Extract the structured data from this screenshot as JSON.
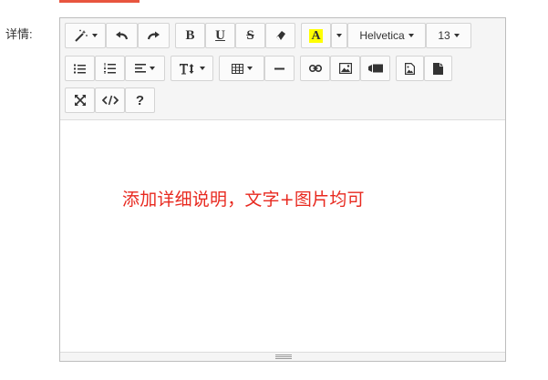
{
  "form": {
    "detail_label": "详情:"
  },
  "toolbar": {
    "font_name": "Helvetica",
    "font_size": "13",
    "highlight_letter": "A",
    "highlight_color": "#ffff00"
  },
  "editor": {
    "placeholder": "添加详细说明，文字+图片均可",
    "placeholder_color": "#e8291f"
  }
}
